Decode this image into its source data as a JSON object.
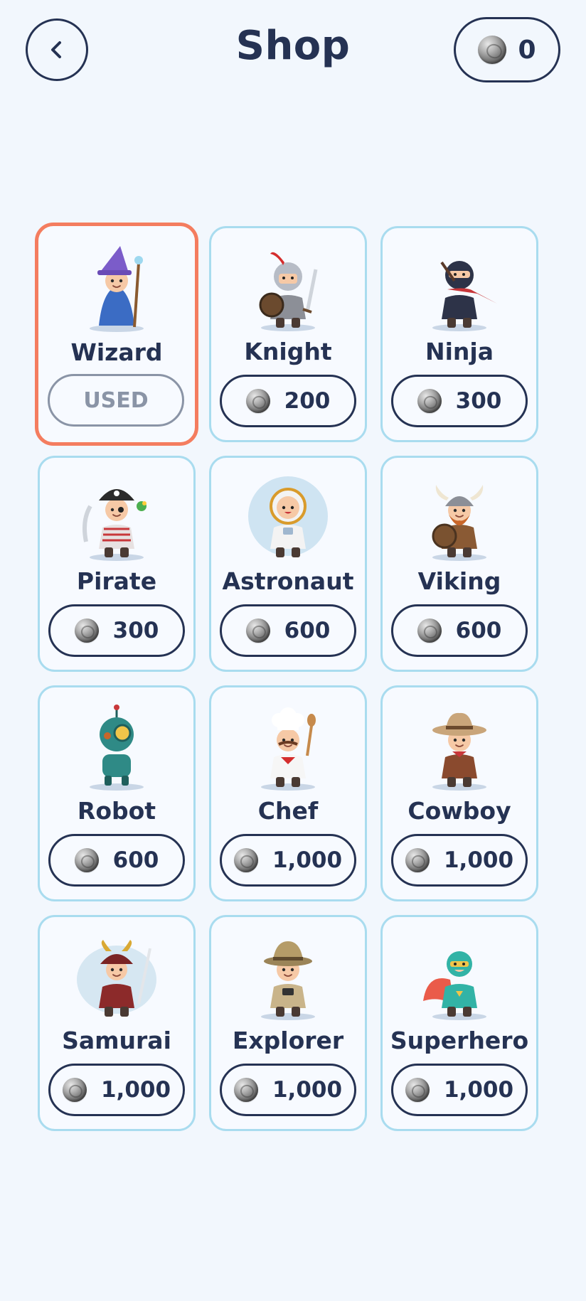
{
  "header": {
    "title": "Shop",
    "back_icon": "chevron-left-icon",
    "balance": "0",
    "coin_icon": "coin-icon"
  },
  "colors": {
    "background": "#f2f7fd",
    "text": "#253253",
    "card_border": "#a9dcef",
    "selected_border": "#f47d5f",
    "used": "#8a94a6"
  },
  "items": [
    {
      "name": "Wizard",
      "price": "USED",
      "status": "used",
      "icon": "wizard-avatar-icon"
    },
    {
      "name": "Knight",
      "price": "200",
      "status": "buy",
      "icon": "knight-avatar-icon"
    },
    {
      "name": "Ninja",
      "price": "300",
      "status": "buy",
      "icon": "ninja-avatar-icon"
    },
    {
      "name": "Pirate",
      "price": "300",
      "status": "buy",
      "icon": "pirate-avatar-icon"
    },
    {
      "name": "Astronaut",
      "price": "600",
      "status": "buy",
      "icon": "astronaut-avatar-icon"
    },
    {
      "name": "Viking",
      "price": "600",
      "status": "buy",
      "icon": "viking-avatar-icon"
    },
    {
      "name": "Robot",
      "price": "600",
      "status": "buy",
      "icon": "robot-avatar-icon"
    },
    {
      "name": "Chef",
      "price": "1,000",
      "status": "buy",
      "icon": "chef-avatar-icon"
    },
    {
      "name": "Cowboy",
      "price": "1,000",
      "status": "buy",
      "icon": "cowboy-avatar-icon"
    },
    {
      "name": "Samurai",
      "price": "1,000",
      "status": "buy",
      "icon": "samurai-avatar-icon"
    },
    {
      "name": "Explorer",
      "price": "1,000",
      "status": "buy",
      "icon": "explorer-avatar-icon"
    },
    {
      "name": "Superhero",
      "price": "1,000",
      "status": "buy",
      "icon": "superhero-avatar-icon"
    }
  ]
}
